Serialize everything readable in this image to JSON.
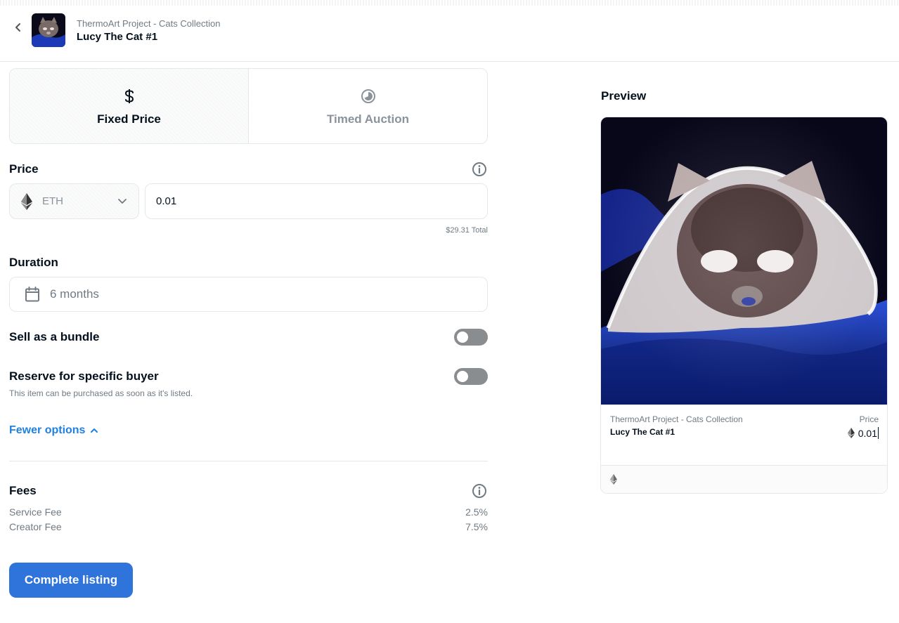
{
  "header": {
    "collection_name": "ThermoArt Project - Cats Collection",
    "item_name": "Lucy The Cat #1"
  },
  "listing_type": {
    "tabs": [
      {
        "label": "Fixed Price",
        "icon": "dollar-icon",
        "active": true
      },
      {
        "label": "Timed Auction",
        "icon": "clock-icon",
        "active": false
      }
    ]
  },
  "price": {
    "label": "Price",
    "currency": "ETH",
    "value": "0.01",
    "total": "$29.31 Total"
  },
  "duration": {
    "label": "Duration",
    "value": "6 months"
  },
  "options": {
    "bundle_label": "Sell as a bundle",
    "bundle_enabled": false,
    "reserve_label": "Reserve for specific buyer",
    "reserve_enabled": false,
    "reserve_hint": "This item can be purchased as soon as it's listed.",
    "fewer_options": "Fewer options"
  },
  "fees": {
    "label": "Fees",
    "items": [
      {
        "name": "Service Fee",
        "value": "2.5%"
      },
      {
        "name": "Creator Fee",
        "value": "7.5%"
      }
    ]
  },
  "actions": {
    "complete_label": "Complete listing"
  },
  "preview": {
    "title": "Preview",
    "collection_name": "ThermoArt Project - Cats Collection",
    "item_name": "Lucy The Cat #1",
    "price_label": "Price",
    "price_value": "0.01"
  },
  "colors": {
    "accent": "#2081e2",
    "button": "#2f74db",
    "toggle_off": "#8a8d90"
  }
}
